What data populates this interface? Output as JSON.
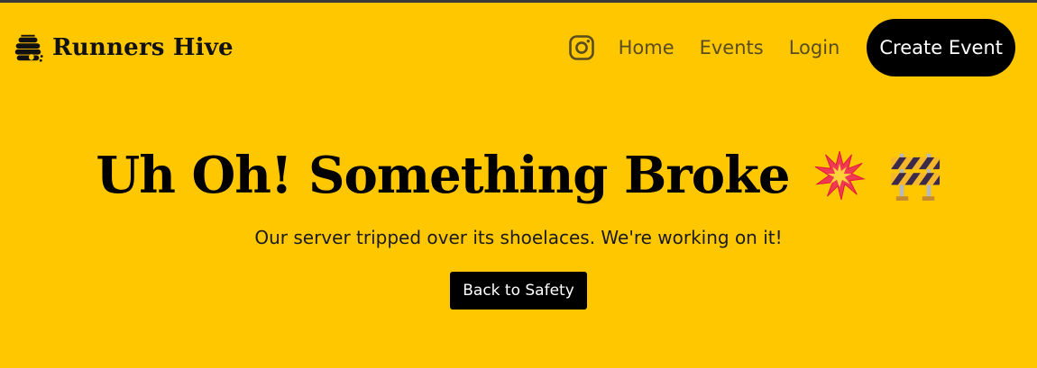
{
  "brand": {
    "name": "Runners Hive",
    "logo_icon": "beehive-icon"
  },
  "nav": {
    "social_icon": "instagram-icon",
    "links": [
      "Home",
      "Events",
      "Login"
    ],
    "cta_label": "Create Event"
  },
  "hero": {
    "title": "Uh Oh! Something Broke",
    "emoji_1": "collision-icon",
    "emoji_2": "construction-barrier-icon",
    "subtitle": "Our server tripped over its shoelaces. We're working on it!",
    "button_label": "Back to Safety"
  },
  "colors": {
    "background": "#ffc700",
    "text": "#000000",
    "nav_link": "#5a4c1e",
    "button_bg": "#000000",
    "button_text": "#ffffff"
  }
}
